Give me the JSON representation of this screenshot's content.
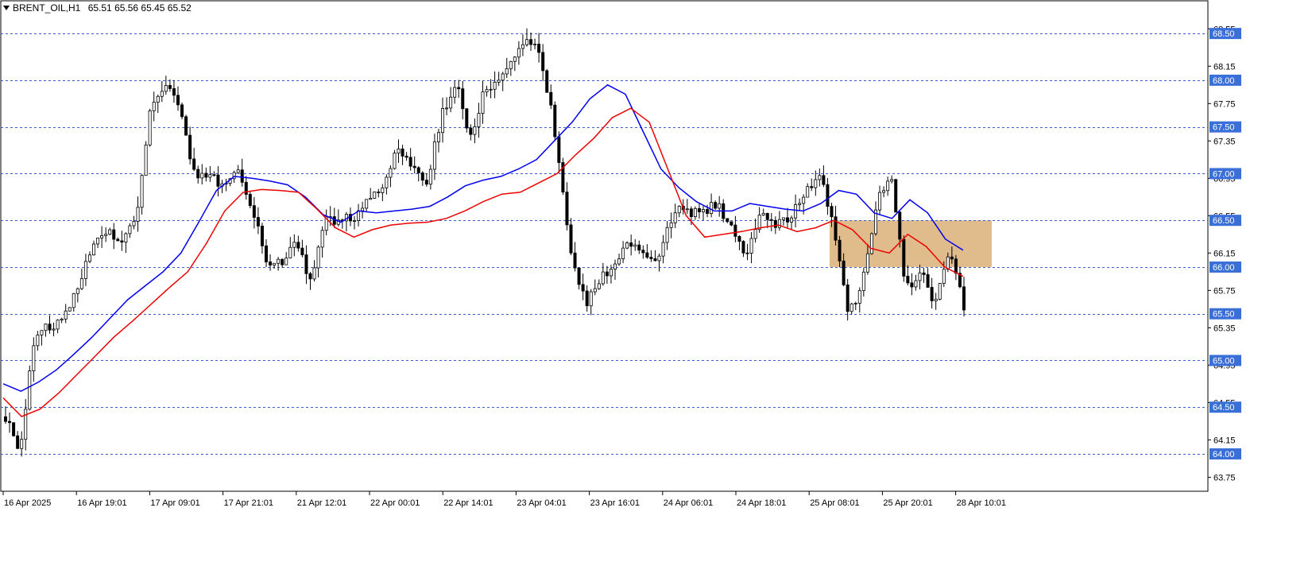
{
  "header": {
    "symbol": "BRENT_OIL,H1",
    "ohlc": "65.51 65.56 65.45 65.52"
  },
  "chart_data": {
    "type": "candlestick",
    "symbol": "BRENT_OIL",
    "timeframe": "H1",
    "ylim": [
      63.6,
      68.85
    ],
    "y_ticks": [
      "68.55",
      "68.15",
      "67.75",
      "67.35",
      "66.95",
      "66.55",
      "66.15",
      "65.75",
      "65.35",
      "64.95",
      "64.55",
      "64.15",
      "63.75"
    ],
    "level_lines": [
      "68.50",
      "68.00",
      "67.50",
      "67.00",
      "66.50",
      "66.00",
      "65.50",
      "65.00",
      "64.50",
      "64.00"
    ],
    "x_labels": [
      "16 Apr 2025",
      "16 Apr 19:01",
      "17 Apr 09:01",
      "17 Apr 21:01",
      "21 Apr 12:01",
      "22 Apr 00:01",
      "22 Apr 14:01",
      "23 Apr 04:01",
      "23 Apr 16:01",
      "24 Apr 06:01",
      "24 Apr 18:01",
      "25 Apr 08:01",
      "25 Apr 20:01",
      "28 Apr 10:01"
    ],
    "zone": {
      "from": 66.0,
      "to": 66.5
    },
    "close_anchors": [
      64.4,
      64.0,
      65.3,
      65.35,
      65.45,
      65.8,
      66.2,
      66.4,
      66.25,
      66.5,
      67.7,
      68.0,
      67.65,
      67.0,
      66.95,
      66.9,
      67.0,
      66.6,
      66.05,
      66.05,
      66.3,
      65.85,
      66.5,
      66.5,
      66.55,
      66.7,
      66.85,
      67.3,
      67.1,
      66.9,
      67.6,
      68.0,
      67.35,
      67.9,
      68.05,
      68.2,
      68.5,
      68.15,
      67.3,
      66.1,
      65.6,
      65.9,
      66.05,
      66.25,
      66.15,
      66.1,
      66.6,
      66.6,
      66.55,
      66.7,
      66.4,
      66.1,
      66.6,
      66.45,
      66.5,
      66.8,
      67.0,
      66.5,
      65.5,
      65.8,
      66.7,
      66.95,
      65.75,
      65.95,
      65.6,
      66.2,
      65.6
    ],
    "series": [
      {
        "color": "#0000ee",
        "values": [
          64.75,
          64.67,
          64.77,
          64.9,
          65.07,
          65.25,
          65.45,
          65.65,
          65.8,
          65.95,
          66.15,
          66.48,
          66.82,
          66.97,
          66.95,
          66.92,
          66.88,
          66.75,
          66.56,
          66.48,
          66.6,
          66.58,
          66.6,
          66.62,
          66.65,
          66.75,
          66.87,
          66.93,
          66.97,
          67.05,
          67.15,
          67.35,
          67.55,
          67.8,
          67.95,
          67.85,
          67.45,
          67.05,
          66.85,
          66.7,
          66.6,
          66.6,
          66.68,
          66.65,
          66.62,
          66.6,
          66.68,
          66.82,
          66.78,
          66.58,
          66.52,
          66.72,
          66.58,
          66.3,
          66.18
        ]
      },
      {
        "color": "#ee0000",
        "values": [
          64.6,
          64.4,
          64.48,
          64.65,
          64.85,
          65.05,
          65.25,
          65.42,
          65.6,
          65.78,
          65.95,
          66.25,
          66.6,
          66.8,
          66.83,
          66.82,
          66.8,
          66.62,
          66.42,
          66.32,
          66.4,
          66.45,
          66.47,
          66.48,
          66.52,
          66.6,
          66.7,
          66.78,
          66.8,
          66.9,
          67.0,
          67.2,
          67.38,
          67.6,
          67.7,
          67.55,
          67.05,
          66.55,
          66.32,
          66.35,
          66.38,
          66.42,
          66.45,
          66.38,
          66.42,
          66.5,
          66.4,
          66.2,
          66.15,
          66.35,
          66.22,
          66.0,
          65.9
        ]
      }
    ]
  }
}
